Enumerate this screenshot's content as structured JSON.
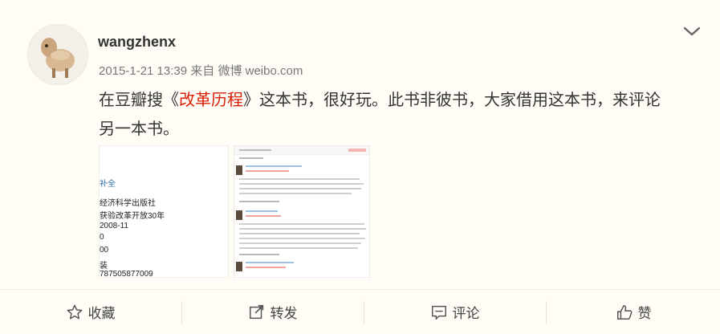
{
  "post": {
    "username": "wangzhenx",
    "timestamp": "2015-1-21 13:39",
    "source_prefix": "来自",
    "source_name": "微博 weibo.com",
    "text_line1_before": "在豆瓣搜《",
    "text_highlight": "改革历程",
    "text_line1_after": "》这本书，很好玩。此书非彼书，大家借用这本书，来评论",
    "text_line2": "另一本书。"
  },
  "image1": {
    "lines": [
      "补全",
      "经济科学出版社",
      "获验改革开放30年",
      "2008-11",
      "0",
      "00",
      "装",
      "787505877009"
    ]
  },
  "actions": {
    "favorite_label": "收藏",
    "repost_label": "转发",
    "comment_label": "评论",
    "like_label": "赞"
  },
  "colors": {
    "highlight": "#d81e06",
    "username": "#333333",
    "meta": "#777777"
  },
  "icons": {
    "menu": "chevron-down-icon",
    "favorite": "star-icon",
    "repost": "share-arrow-icon",
    "comment": "speech-bubble-icon",
    "like": "thumbs-up-icon"
  }
}
